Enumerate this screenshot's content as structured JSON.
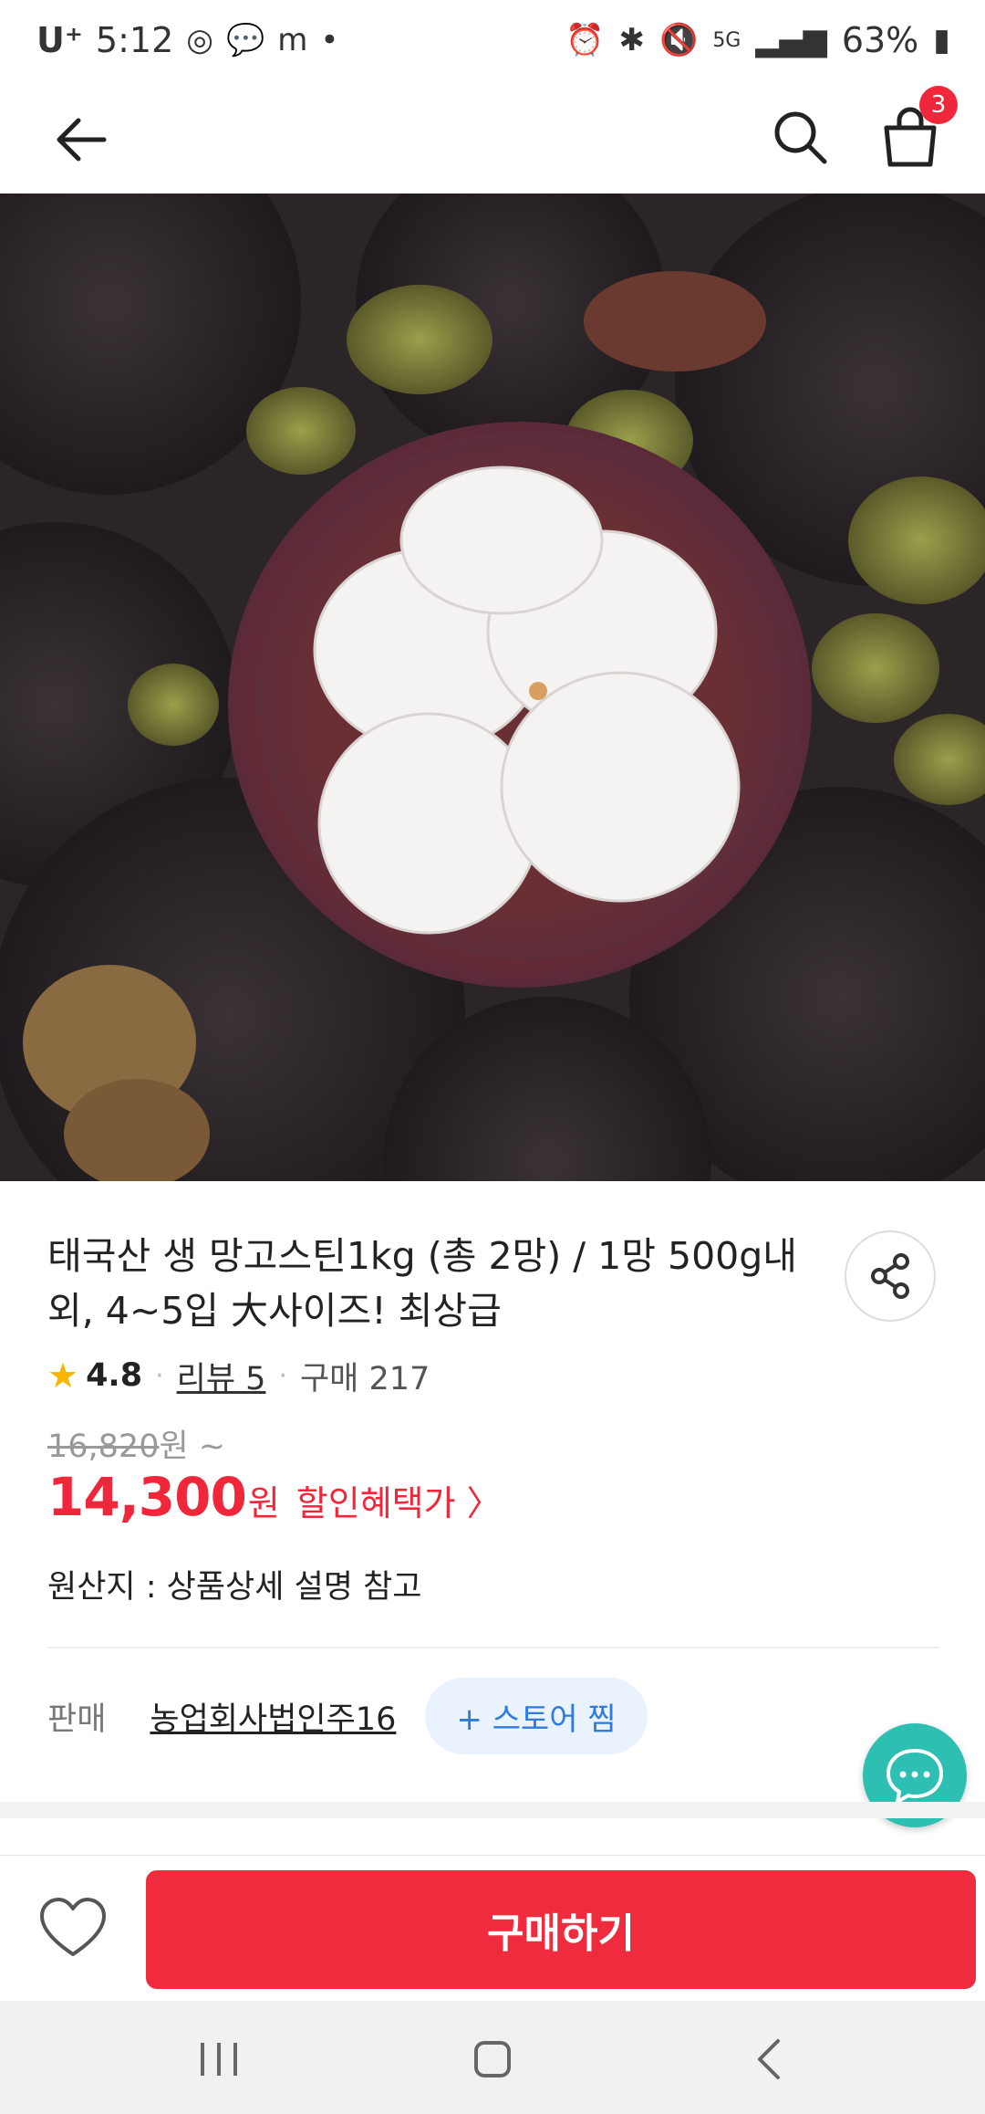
{
  "status_bar": {
    "carrier": "U⁺",
    "time": "5:12",
    "battery": "63%"
  },
  "header": {
    "cart_count": "3"
  },
  "hero": {
    "image_description_icon": "mangosteen-photo",
    "slide_count": 8,
    "active_slide": 1
  },
  "product": {
    "title": "태국산 생 망고스틴1kg (총 2망) / 1망 500g내외, 4~5입 大사이즈! 최상급",
    "rating": "4.8",
    "review_label": "리뷰 5",
    "purchase_label": "구매 217",
    "original_price": "16,820",
    "original_price_suffix": "원 ~",
    "sale_price": "14,300",
    "sale_unit": "원",
    "benefit_label": "할인혜택가 〉",
    "origin_text": "원산지 : 상품상세 설명 참고"
  },
  "seller": {
    "label": "판매",
    "name": "농업회사법인주16",
    "store_button": "+ 스토어 찜"
  },
  "bottom": {
    "buy_label": "구매하기"
  },
  "colors": {
    "accent": "#f0273a",
    "chat": "#2dbfb2",
    "store_btn_bg": "#eaf3fd",
    "store_btn_text": "#2d7be0"
  }
}
